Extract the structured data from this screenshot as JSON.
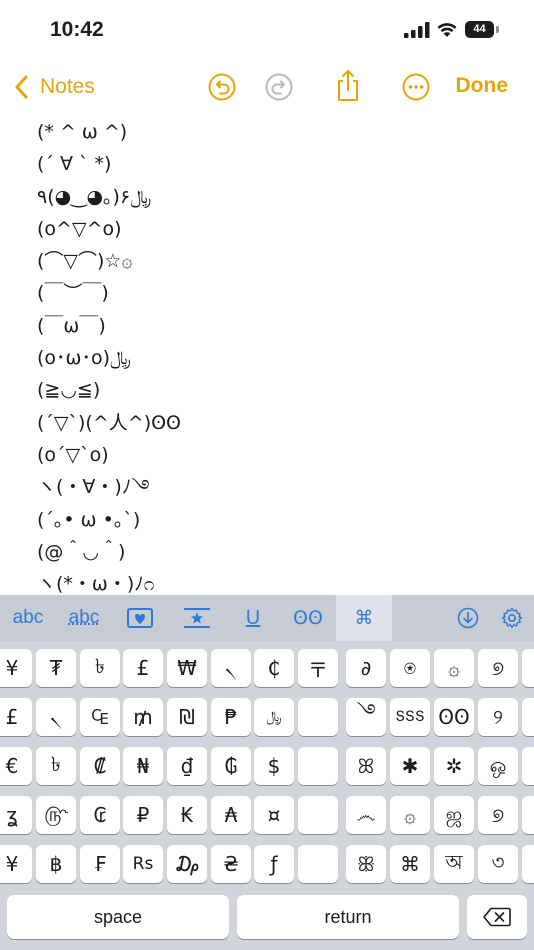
{
  "status": {
    "time": "10:42",
    "battery": "44"
  },
  "nav": {
    "back_label": "Notes",
    "done_label": "Done"
  },
  "note_lines": [
    "(* ^ ω ^)",
    "(´ ∀ ` *)",
    "٩(◕‿◕｡)۶﷼",
    "(o^▽^o)",
    "(⌒▽⌒)☆۞",
    "(￣︶￣)",
    "(￣ω￣)",
    "(o･ω･o)﷼",
    "(≧◡≦)",
    "(´▽`)(^人^)ʘʘ",
    "(o´▽`o)",
    "ヽ(・∀・)ﾉ࿓",
    "(´｡• ω •｡`)",
    "(@＾◡＾)",
    "ヽ(*・ω・)ﾉ೧"
  ],
  "keyboard": {
    "tabs": [
      "abc",
      "abc",
      "♥",
      "★",
      "U",
      "ʘʘ",
      "⌘",
      "⬇",
      "⚙"
    ],
    "left_rows": [
      [
        "¥",
        "₮",
        "৳",
        "£",
        "₩",
        "৲",
        "₵",
        "〒"
      ],
      [
        "£",
        "৲",
        "₠",
        "₥",
        "₪",
        "₱",
        "﷼",
        ""
      ],
      [
        "€",
        "৳",
        "₡",
        "₦",
        "₫",
        "₲",
        "$",
        ""
      ],
      [
        "ʓ",
        "௹",
        "₢",
        "₽",
        "₭",
        "₳",
        "¤",
        ""
      ],
      [
        "¥",
        "฿",
        "₣",
        "Rs",
        "₯",
        "₴",
        "ƒ",
        ""
      ]
    ],
    "right_rows": [
      [
        "∂",
        "⍟",
        "۞",
        "୭"
      ],
      [
        "࿓",
        "ՏՏՏ",
        "ʘʘ",
        "୨"
      ],
      [
        "ꕤ",
        "✱",
        "✲",
        "ஒ"
      ],
      [
        "෴",
        "۞",
        "ஜ",
        "୭"
      ],
      [
        "ꕥ",
        "⌘",
        "অ",
        "৩"
      ]
    ],
    "space_label": "space",
    "return_label": "return"
  },
  "colors": {
    "accent": "#e5a50a",
    "keyboard_blue": "#2f7ad8"
  }
}
